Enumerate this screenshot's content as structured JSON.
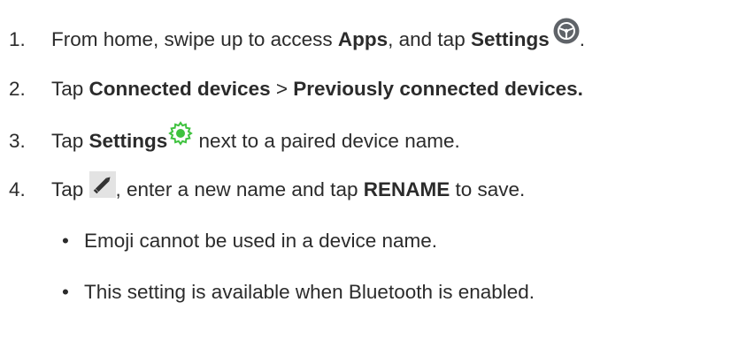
{
  "steps": [
    {
      "number": "1.",
      "parts": {
        "t1": "From home, swipe up to access ",
        "b1": "Apps",
        "t2": ", and tap ",
        "b2": "Settings",
        "t3": "."
      },
      "icon": "steering-wheel-settings-icon"
    },
    {
      "number": "2.",
      "parts": {
        "t1": "Tap ",
        "b1": "Connected devices",
        "t2": " > ",
        "b2": "Previously connected devices."
      }
    },
    {
      "number": "3.",
      "parts": {
        "t1": "Tap ",
        "b1": "Settings",
        "t2": " next to a paired device name."
      },
      "icon": "gear-icon"
    },
    {
      "number": "4.",
      "parts": {
        "t1": "Tap ",
        "t2": ", enter a new name and tap ",
        "b1": "RENAME",
        "t3": " to save."
      },
      "icon": "pencil-icon"
    }
  ],
  "bullets": [
    {
      "symbol": "•",
      "text": "Emoji cannot be used in a device name."
    },
    {
      "symbol": "•",
      "text": "This setting is available when Bluetooth is enabled."
    }
  ],
  "colors": {
    "text": "#2b2b2b",
    "settings_icon_fill": "#5f6368",
    "gear_icon": "#3ec23e",
    "pencil_icon": "#333333",
    "pencil_bg": "#e3e3e3"
  }
}
